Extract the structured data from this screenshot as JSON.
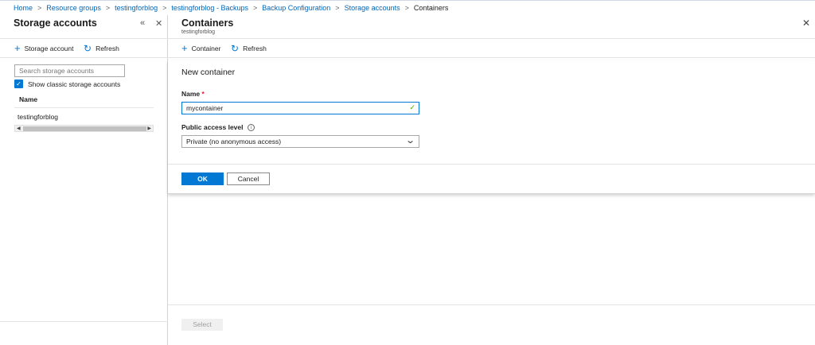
{
  "breadcrumb": {
    "items": [
      "Home",
      "Resource groups",
      "testingforblog",
      "testingforblog - Backups",
      "Backup Configuration",
      "Storage accounts"
    ],
    "current": "Containers",
    "separator": ">"
  },
  "left_blade": {
    "title": "Storage accounts",
    "collapse_glyph": "«",
    "close_glyph": "✕",
    "toolbar": {
      "add_label": "Storage account",
      "refresh_label": "Refresh"
    },
    "search_placeholder": "Search storage accounts",
    "classic_checkbox_label": "Show classic storage accounts",
    "classic_checked": true,
    "column_header": "Name",
    "rows": [
      "testingforblog"
    ]
  },
  "right_blade": {
    "title": "Containers",
    "subtitle": "testingforblog",
    "close_glyph": "✕",
    "toolbar": {
      "add_label": "Container",
      "refresh_label": "Refresh"
    },
    "new_container": {
      "title": "New container",
      "name_label": "Name",
      "required_marker": "*",
      "name_value": "mycontainer",
      "access_label": "Public access level",
      "access_value": "Private (no anonymous access)",
      "ok_label": "OK",
      "cancel_label": "Cancel"
    },
    "select_label": "Select"
  },
  "colors": {
    "accent": "#0078d4",
    "link": "#0066b8",
    "valid": "#57a300",
    "required": "#e81123"
  }
}
